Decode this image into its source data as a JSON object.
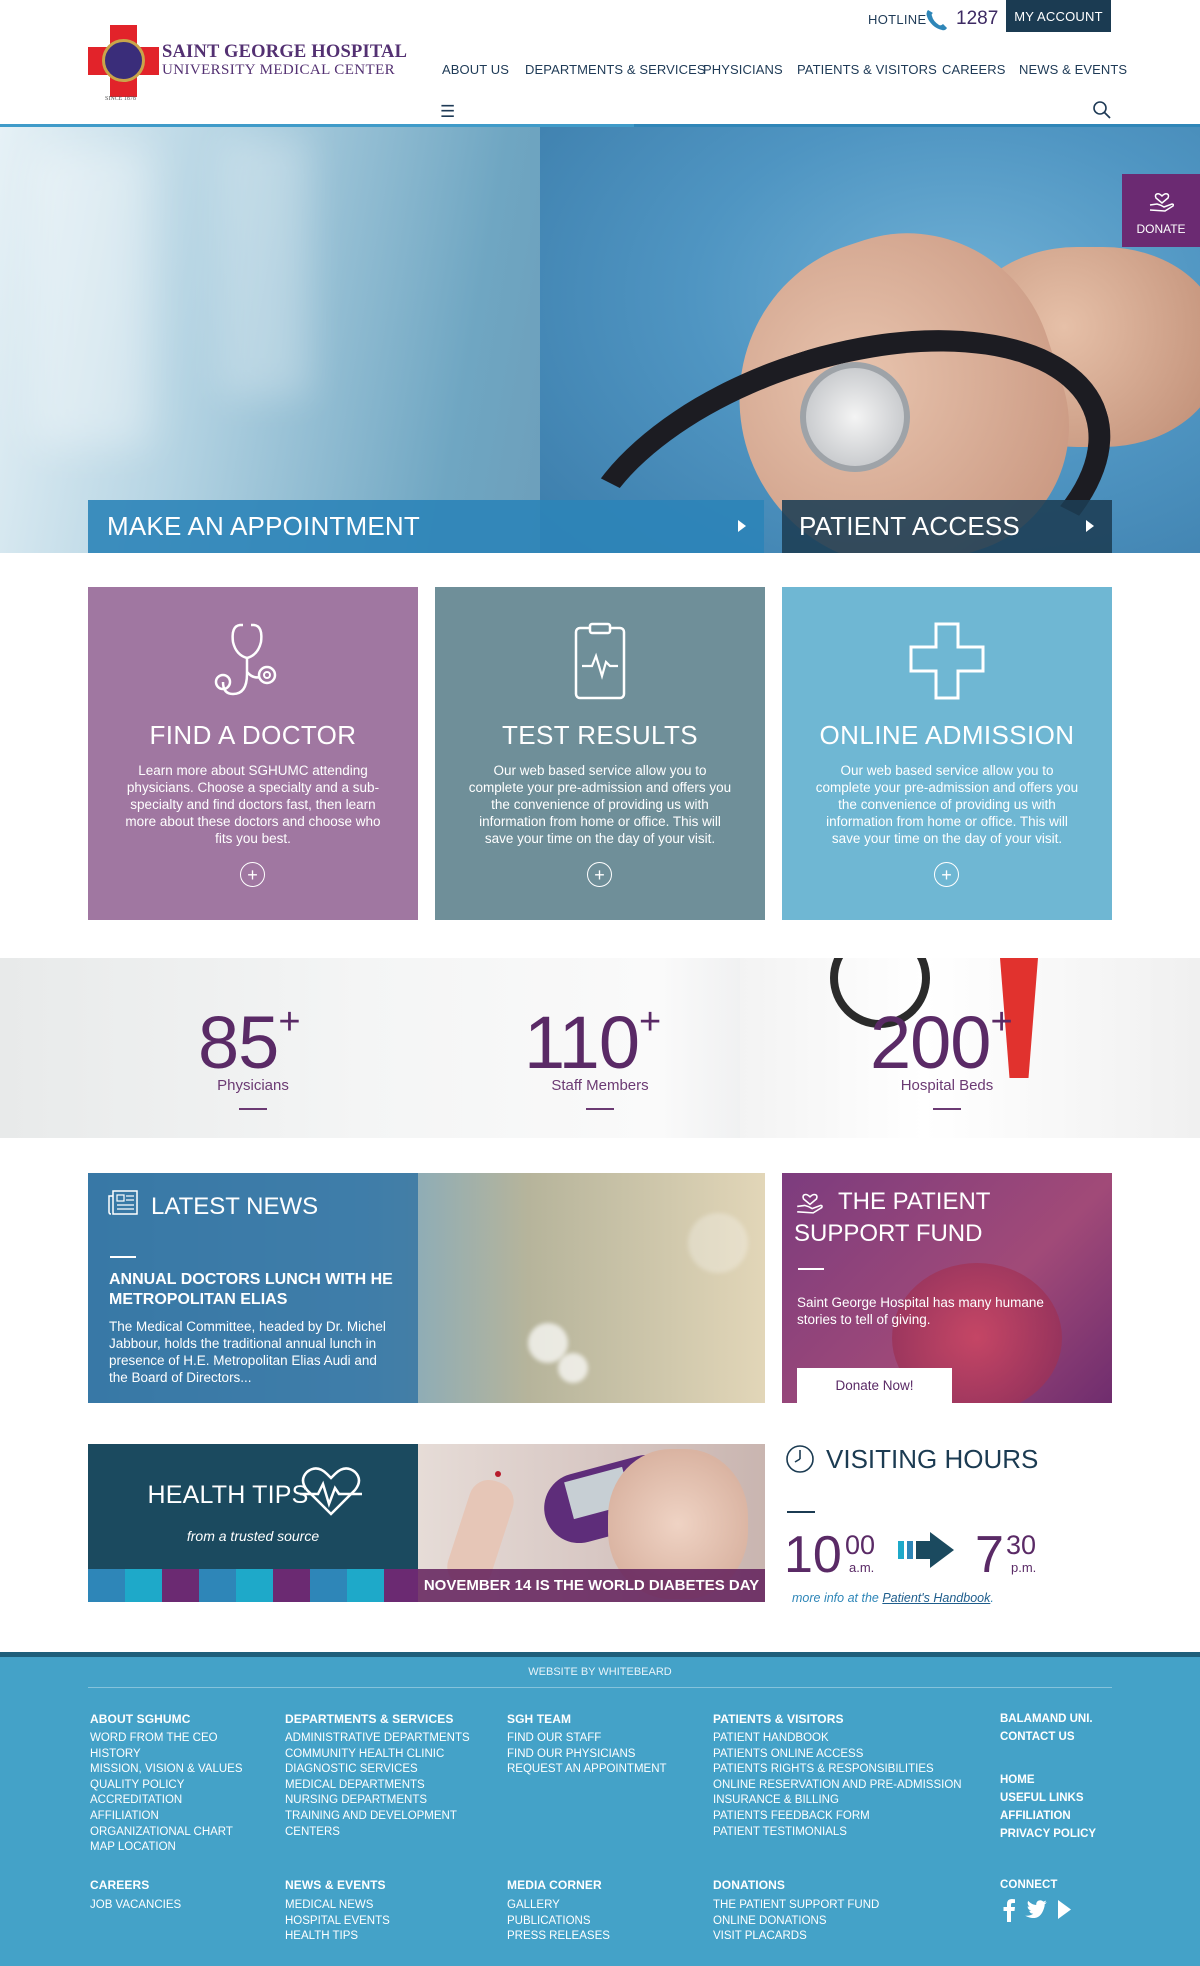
{
  "header": {
    "logo_line1": "SAINT GEORGE HOSPITAL",
    "logo_line2": "UNIVERSITY MEDICAL CENTER",
    "logo_since": "SINCE 1878",
    "hotline_label": "HOTLINE",
    "hotline_number": "1287",
    "account_label": "MY ACCOUNT",
    "nav": [
      "ABOUT US",
      "DEPARTMENTS & SERVICES",
      "PHYSICIANS",
      "PATIENTS & VISITORS",
      "CAREERS",
      "NEWS & EVENTS"
    ],
    "menu_icon": "☰"
  },
  "hero": {
    "cta_appointment": "MAKE AN APPOINTMENT",
    "cta_patient_access": "PATIENT ACCESS",
    "donate_label": "DONATE"
  },
  "cards": [
    {
      "title": "FIND A DOCTOR",
      "text": "Learn more about SGHUMC attending physicians. Choose a specialty and a sub-specialty and find doctors fast, then learn more about these doctors and choose who fits you best.",
      "plus": "+"
    },
    {
      "title": "TEST RESULTS",
      "text": "Our web based service allow you to complete your pre-admission and offers you the convenience of providing us with information from home or office. This will save your time on the day of your visit.",
      "plus": "+"
    },
    {
      "title": "ONLINE ADMISSION",
      "text": "Our web based service allow you to complete your pre-admission and offers you the convenience of providing us with information from home or office. This will save your time on the day of your visit.",
      "plus": "+"
    }
  ],
  "stats": [
    {
      "number": "85",
      "suffix": "+",
      "label": "Physicians"
    },
    {
      "number": "110",
      "suffix": "+",
      "label": "Staff Members"
    },
    {
      "number": "200",
      "suffix": "+",
      "label": "Hospital Beds"
    }
  ],
  "news": {
    "heading": "LATEST NEWS",
    "title": "ANNUAL DOCTORS LUNCH WITH HE METROPOLITAN ELIAS",
    "body": "The Medical Committee, headed by Dr. Michel Jabbour, holds the traditional annual lunch in presence of H.E. Metropolitan Elias Audi and the Board of Directors..."
  },
  "fund": {
    "heading": "THE PATIENT SUPPORT FUND",
    "body": "Saint George Hospital has many humane stories to tell of giving.",
    "button": "Donate Now!"
  },
  "tips": {
    "heading": "HEALTH TIPS",
    "subheading": "from a trusted source",
    "caption": "NOVEMBER 14 IS THE WORLD DIABETES DAY"
  },
  "visiting": {
    "heading": "VISITING HOURS",
    "open_hour": "10",
    "open_min": "00",
    "open_period": "a.m.",
    "close_hour": "7",
    "close_min": "30",
    "close_period": "p.m.",
    "more_prefix": "more info at the ",
    "more_link": "Patient's Handbook",
    "more_suffix": "."
  },
  "footer": {
    "credit": "WEBSITE BY WHITEBEARD",
    "col1_h": "ABOUT SGHUMC",
    "col1": [
      "WORD FROM THE CEO",
      "HISTORY",
      "MISSION, VISION & VALUES",
      "QUALITY POLICY",
      "ACCREDITATION",
      "AFFILIATION",
      "ORGANIZATIONAL CHART",
      "MAP LOCATION"
    ],
    "col2_h": "DEPARTMENTS & SERVICES",
    "col2": [
      "ADMINISTRATIVE DEPARTMENTS",
      "COMMUNITY HEALTH CLINIC",
      "DIAGNOSTIC SERVICES",
      "MEDICAL DEPARTMENTS",
      "NURSING DEPARTMENTS",
      "TRAINING AND DEVELOPMENT",
      "CENTERS"
    ],
    "col3_h": "SGH TEAM",
    "col3": [
      "FIND OUR STAFF",
      "FIND OUR PHYSICIANS",
      "REQUEST AN APPOINTMENT"
    ],
    "col4_h": "PATIENTS & VISITORS",
    "col4": [
      "PATIENT HANDBOOK",
      "PATIENTS ONLINE ACCESS",
      "PATIENTS RIGHTS & RESPONSIBILITIES",
      "ONLINE RESERVATION AND PRE-ADMISSION",
      "INSURANCE & BILLING",
      "PATIENTS FEEDBACK FORM",
      "PATIENT TESTIMONIALS"
    ],
    "col5a": [
      "BALAMAND UNI.",
      "CONTACT US"
    ],
    "col5b": [
      "HOME",
      "USEFUL LINKS",
      "AFFILIATION",
      "PRIVACY POLICY"
    ],
    "row2_h1": "CAREERS",
    "row2_1": [
      "JOB VACANCIES"
    ],
    "row2_h2": "NEWS & EVENTS",
    "row2_2": [
      "MEDICAL NEWS",
      "HOSPITAL EVENTS",
      "HEALTH TIPS"
    ],
    "row2_h3": "MEDIA CORNER",
    "row2_3": [
      "GALLERY",
      "PUBLICATIONS",
      "PRESS RELEASES"
    ],
    "row2_h4": "DONATIONS",
    "row2_4": [
      "THE PATIENT SUPPORT FUND",
      "ONLINE DONATIONS",
      "VISIT PLACARDS"
    ],
    "connect": "CONNECT",
    "social_icons": [
      "facebook-icon",
      "twitter-icon",
      "youtube-icon"
    ]
  },
  "colors": {
    "brand_purple": "#533072",
    "card_purple": "#a077a1",
    "card_gray": "#6f8f99",
    "card_blue": "#6fb7d3",
    "navy": "#1b3b52",
    "footer_blue": "#44a2c8"
  }
}
